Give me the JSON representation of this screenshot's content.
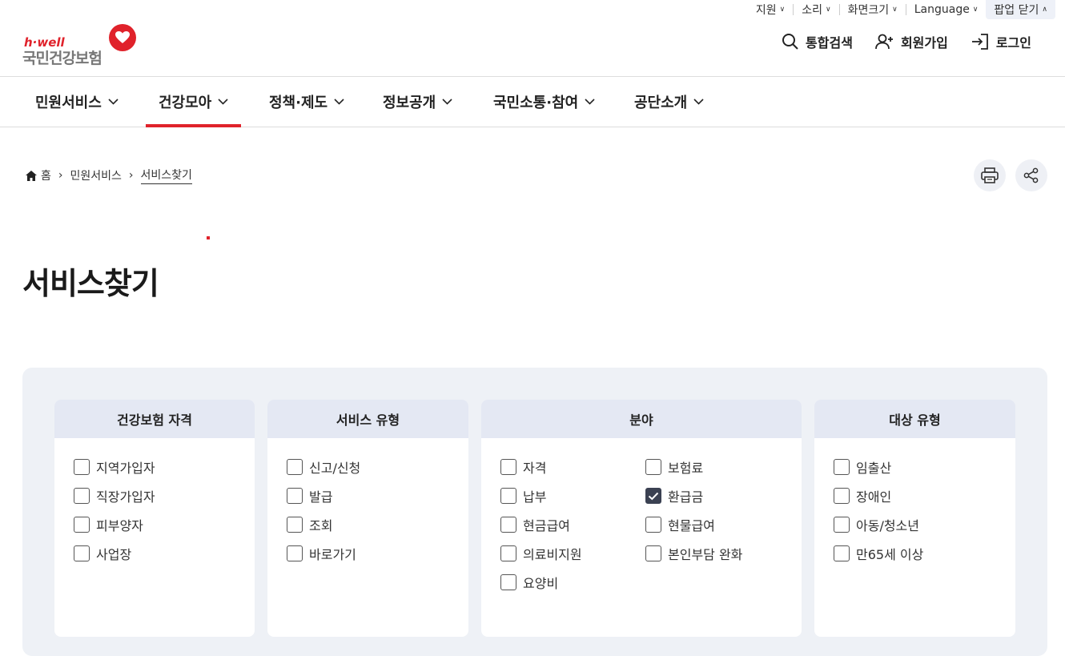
{
  "util": {
    "support": "지원",
    "sound": "소리",
    "screen_size": "화면크기",
    "language": "Language",
    "popup_close": "팝업 닫기"
  },
  "logo": {
    "brand": "h·well",
    "name": "국민건강보험"
  },
  "header": {
    "search": "통합검색",
    "signup": "회원가입",
    "login": "로그인"
  },
  "gnb": [
    "민원서비스",
    "건강모아",
    "정책·제도",
    "정보공개",
    "국민소통·참여",
    "공단소개"
  ],
  "breadcrumb": {
    "home": "홈",
    "level1": "민원서비스",
    "current": "서비스찾기"
  },
  "page": {
    "title": "서비스찾기"
  },
  "filters": {
    "qualification": {
      "title": "건강보험 자격",
      "options": [
        "지역가입자",
        "직장가입자",
        "피부양자",
        "사업장"
      ]
    },
    "service_type": {
      "title": "서비스 유형",
      "options": [
        "신고/신청",
        "발급",
        "조회",
        "바로가기"
      ]
    },
    "field": {
      "title": "분야",
      "options": [
        "자격",
        "보험료",
        "납부",
        "환급금",
        "현금급여",
        "현물급여",
        "의료비지원",
        "본인부담 완화",
        "요양비"
      ],
      "checked": [
        "환급금"
      ]
    },
    "target_type": {
      "title": "대상 유형",
      "options": [
        "임출산",
        "장애인",
        "아동/청소년",
        "만65세 이상"
      ]
    }
  },
  "colors": {
    "accent": "#e0222b",
    "checked": "#3b4152",
    "panel_bg": "#eef1f6",
    "box_header": "#e4e8f3"
  }
}
